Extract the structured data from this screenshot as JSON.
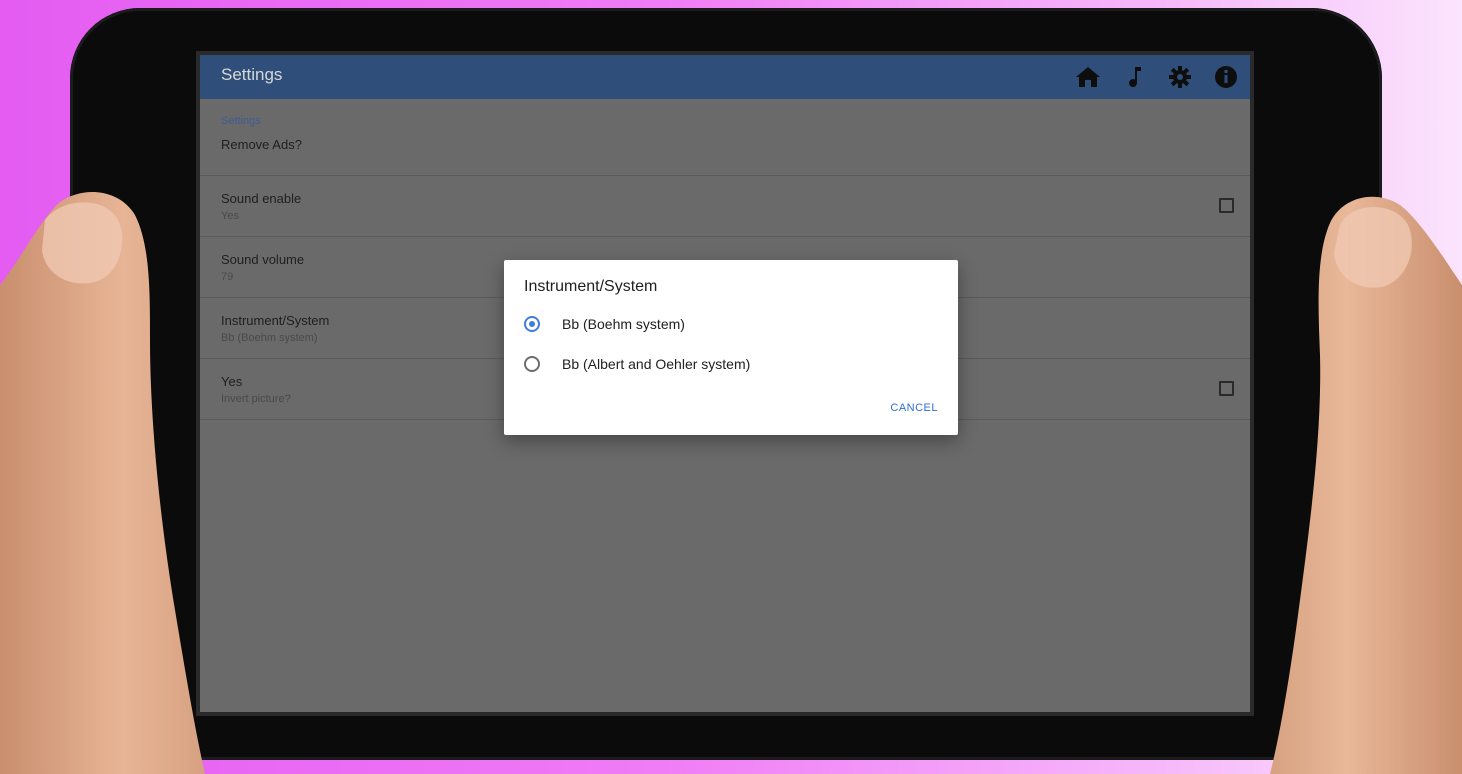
{
  "appbar": {
    "title": "Settings",
    "icons": [
      "home-icon",
      "music-note-icon",
      "gear-icon",
      "info-icon"
    ]
  },
  "settings": {
    "section_header": "Settings",
    "remove_ads": "Remove Ads?",
    "sound_enable": {
      "title": "Sound enable",
      "summary": "Yes",
      "checked": false
    },
    "sound_volume": {
      "title": "Sound volume",
      "summary": "79"
    },
    "instrument": {
      "title": "Instrument/System",
      "summary": "Bb (Boehm system)"
    },
    "invert": {
      "title": "Yes",
      "summary": "Invert picture?",
      "checked": false
    }
  },
  "dialog": {
    "title": "Instrument/System",
    "options": [
      {
        "label": "Bb (Boehm system)",
        "selected": true
      },
      {
        "label": "Bb (Albert and Oehler system)",
        "selected": false
      }
    ],
    "cancel_label": "CANCEL"
  },
  "colors": {
    "appbar": "#2f4f7a",
    "accent": "#3f7de0",
    "background_left": "#e45cf2",
    "background_right": "#fbe4fd"
  }
}
